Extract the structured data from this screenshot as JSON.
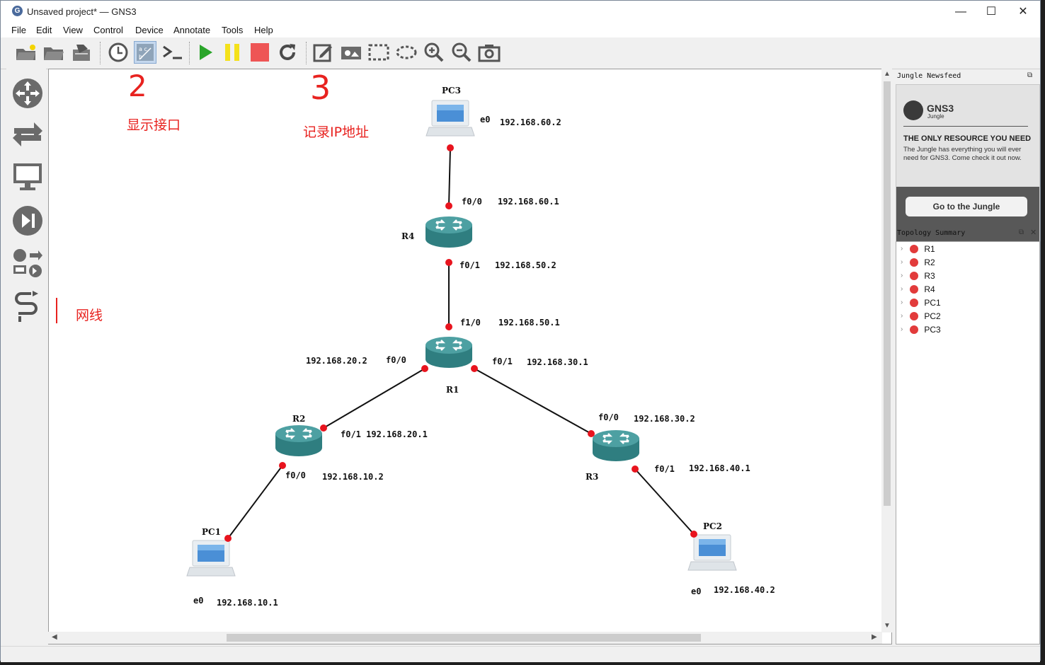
{
  "window": {
    "title": "Unsaved project* — GNS3",
    "minimize": "—",
    "maximize": "☐",
    "close": "✕"
  },
  "menu": [
    "File",
    "Edit",
    "View",
    "Control",
    "Device",
    "Annotate",
    "Tools",
    "Help"
  ],
  "toolbar_icons": [
    "new-project-icon",
    "open-project-icon",
    "save-project-icon",
    "snapshot-clock-icon",
    "show-interface-labels-icon",
    "console-all-icon",
    "start-all-icon",
    "suspend-all-icon",
    "stop-all-icon",
    "reload-all-icon",
    "add-note-icon",
    "insert-image-icon",
    "draw-rectangle-icon",
    "draw-ellipse-icon",
    "zoom-in-icon",
    "zoom-out-icon",
    "screenshot-icon"
  ],
  "annotations": {
    "two": "2",
    "show_interfaces": "显示接口",
    "three": "3",
    "record_ip": "记录IP地址",
    "cable": "网线"
  },
  "topology": {
    "nodes": [
      {
        "name": "PC3",
        "type": "pc"
      },
      {
        "name": "R4",
        "type": "router"
      },
      {
        "name": "R1",
        "type": "router"
      },
      {
        "name": "R2",
        "type": "router"
      },
      {
        "name": "R3",
        "type": "router"
      },
      {
        "name": "PC1",
        "type": "pc"
      },
      {
        "name": "PC2",
        "type": "pc"
      }
    ],
    "labels": {
      "pc3_if": "e0",
      "pc3_ip": "192.168.60.2",
      "r4_f00": "f0/0",
      "r4_f00_ip": "192.168.60.1",
      "r4_f01": "f0/1",
      "r4_f01_ip": "192.168.50.2",
      "r1_f10": "f1/0",
      "r1_f10_ip": "192.168.50.1",
      "r1_f00_ip": "192.168.20.2",
      "r1_f00": "f0/0",
      "r1_f01": "f0/1",
      "r1_f01_ip": "192.168.30.1",
      "r2_f01": "f0/1 192.168.20.1",
      "r2_f00": "f0/0",
      "r2_f00_ip": "192.168.10.2",
      "r3_f00": "f0/0",
      "r3_f00_ip": "192.168.30.2",
      "r3_f01": "f0/1",
      "r3_f01_ip": "192.168.40.1",
      "pc1_if": "e0",
      "pc1_ip": "192.168.10.1",
      "pc2_if": "e0",
      "pc2_ip": "192.168.40.2"
    }
  },
  "panels": {
    "newsfeed_title": "Jungle Newsfeed",
    "gns3_logo": "GNS3",
    "gns3_sub": "Jungle",
    "headline": "THE ONLY RESOURCE YOU NEED",
    "body": "The Jungle has everything you will ever need for GNS3. Come check it out now.",
    "button": "Go to the Jungle",
    "topology_title": "Topology Summary",
    "topology_items": [
      "R1",
      "R2",
      "R3",
      "R4",
      "PC1",
      "PC2",
      "PC3"
    ]
  },
  "colors": {
    "router": "#3a8c8c",
    "link_dot": "#e8141e",
    "annotation": "#e8221f",
    "status_red": "#e23b3b"
  }
}
